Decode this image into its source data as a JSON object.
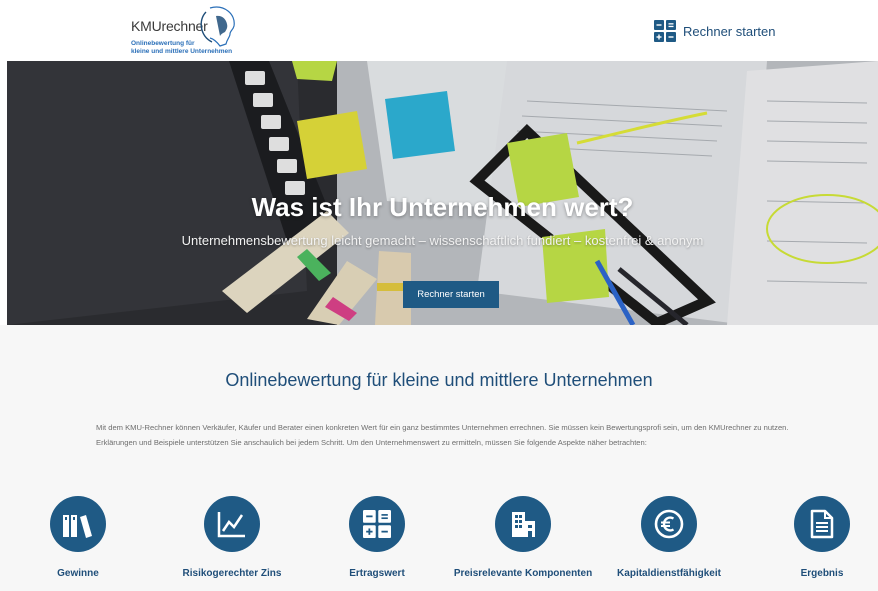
{
  "header": {
    "logo_name": "KMUrechner",
    "logo_line1": "Onlinebewertung für",
    "logo_line2": "kleine und mittlere Unternehmen",
    "cta_label": "Rechner starten"
  },
  "hero": {
    "title": "Was ist Ihr Unternehmen wert?",
    "subtitle": "Unternehmensbewertung leicht gemacht – wissenschaftlich fundiert – kostenfrei & anonym",
    "button_label": "Rechner starten"
  },
  "intro": {
    "title": "Onlinebewertung für kleine und mittlere Unternehmen",
    "text": "Mit dem KMU-Rechner können Verkäufer, Käufer und Berater einen konkreten Wert für ein ganz bestimmtes Unternehmen errechnen. Sie müssen kein Bewertungsprofi sein, um den KMUrechner zu nutzen. Erklärungen und Beispiele unterstützen Sie anschaulich bei jedem Schritt. Um den Unternehmenswert zu ermitteln, müssen Sie folgende Aspekte näher betrachten:"
  },
  "features": [
    {
      "label": "Gewinne",
      "icon": "books-icon"
    },
    {
      "label": "Risikogerechter Zins",
      "icon": "line-chart-icon"
    },
    {
      "label": "Ertragswert",
      "icon": "calculator-icon"
    },
    {
      "label": "Preisrelevante Komponenten",
      "icon": "buildings-icon"
    },
    {
      "label": "Kapitaldienstfähigkeit",
      "icon": "euro-icon"
    },
    {
      "label": "Ergebnis",
      "icon": "document-icon"
    }
  ],
  "colors": {
    "brand_dark": "#1f4e79",
    "button": "#1f5a85",
    "logo_blue": "#2a6fb8"
  }
}
